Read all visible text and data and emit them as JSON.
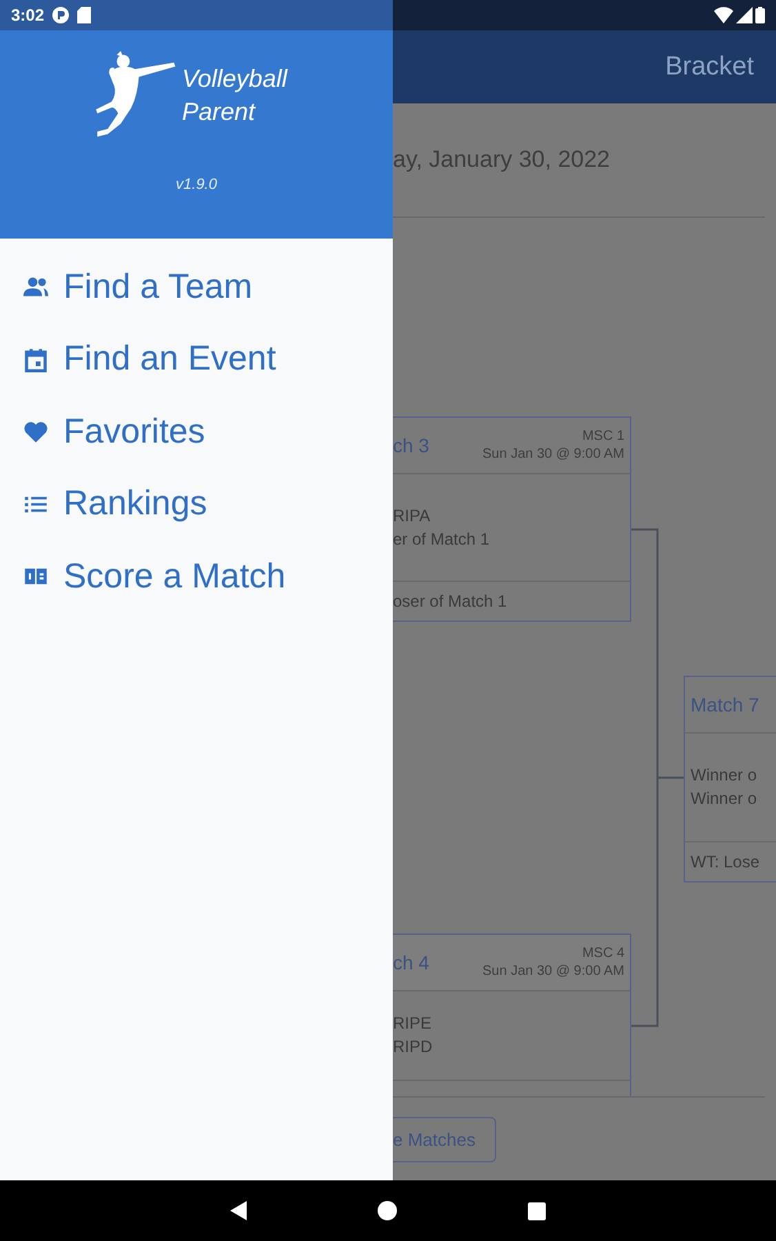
{
  "status_bar": {
    "time": "3:02"
  },
  "drawer": {
    "app_name": "Volleyball Parent",
    "version": "v1.9.0",
    "items": [
      {
        "kind": "team",
        "label": "Find a Team"
      },
      {
        "kind": "event",
        "label": "Find an Event"
      },
      {
        "kind": "favorites",
        "label": "Favorites"
      },
      {
        "kind": "rankings",
        "label": "Rankings"
      },
      {
        "kind": "score",
        "label": "Score a Match"
      }
    ]
  },
  "background": {
    "app_bar_title": "Bracket",
    "date": "ay, January 30, 2022",
    "matches": [
      {
        "title": "ch 3",
        "court": "MSC 1",
        "time": "Sun Jan 30 @ 9:00 AM",
        "teams": [
          "RIPA",
          "er of Match 1"
        ],
        "footer": "oser of Match 1"
      },
      {
        "title": "Match 7",
        "teams": [
          "Winner o",
          "Winner o"
        ],
        "footer": "WT: Lose"
      },
      {
        "title": "ch 4",
        "court": "MSC 4",
        "time": "Sun Jan 30 @ 9:00 AM",
        "teams": [
          "RIPE",
          "RIPD"
        ]
      }
    ],
    "button": "e Matches"
  }
}
